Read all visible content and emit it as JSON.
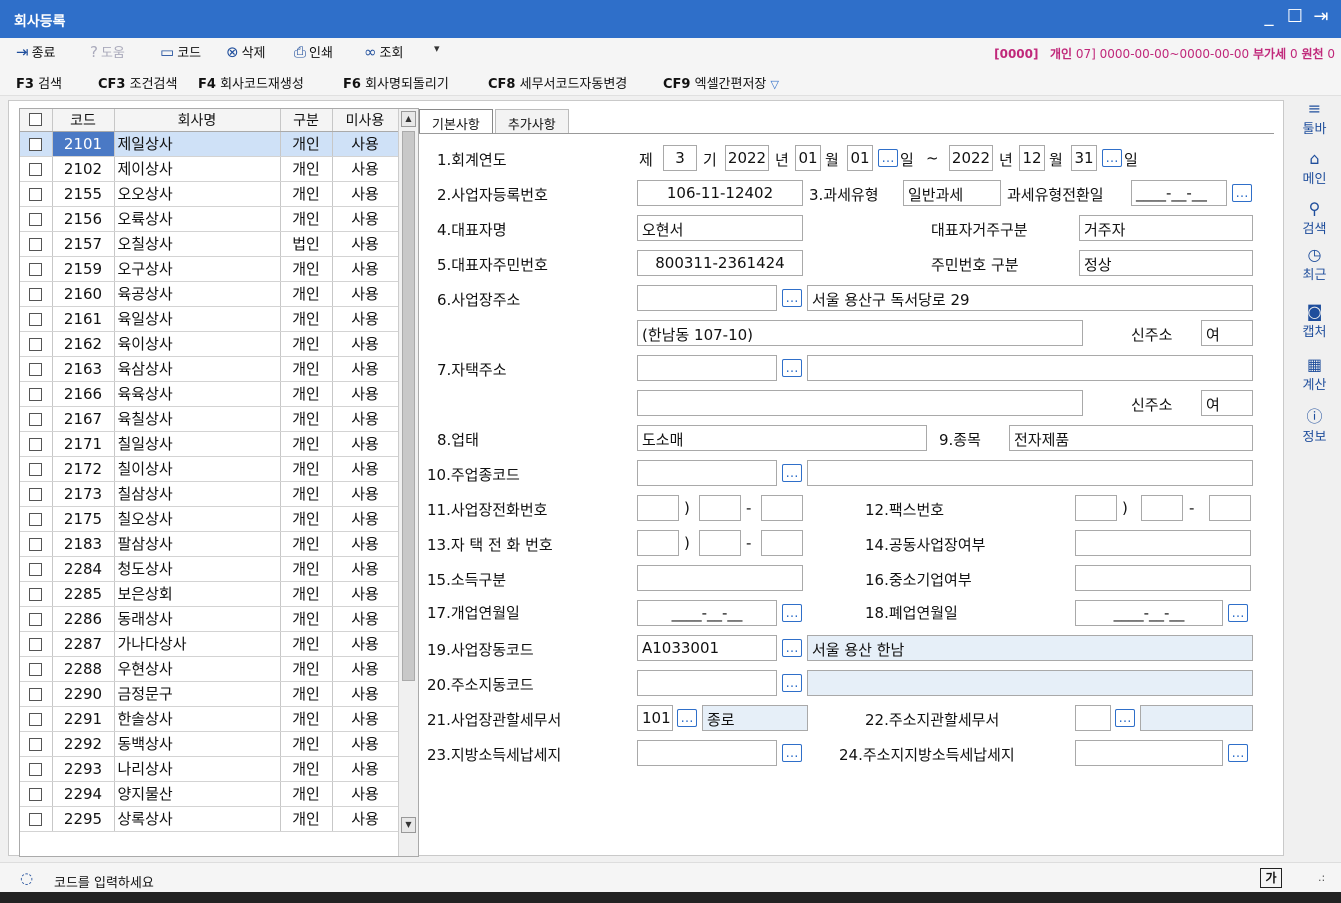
{
  "window": {
    "title": "회사등록",
    "min": "_",
    "max": "☐",
    "close": "⇥"
  },
  "toolbar": [
    {
      "icon": "⇥",
      "label": "종료",
      "name": "exit"
    },
    {
      "icon": "?",
      "label": "도움",
      "name": "help",
      "disabled": true
    },
    {
      "icon": "▭",
      "label": "코드",
      "name": "code"
    },
    {
      "icon": "⊗",
      "label": "삭제",
      "name": "delete"
    },
    {
      "icon": "⎙",
      "label": "인쇄",
      "name": "print"
    },
    {
      "icon": "∞",
      "label": "조회",
      "name": "search"
    },
    {
      "icon": "▾",
      "label": "",
      "name": "more"
    }
  ],
  "info": {
    "code": "[0000]",
    "type": "개인",
    "num": "07]",
    "period": "0000-00-00~0000-00-00",
    "vat_label": "부가세",
    "vat": "0",
    "withholding_label": "원천",
    "withholding": "0"
  },
  "fkeys": [
    {
      "key": "F3",
      "label": "검색"
    },
    {
      "key": "CF3",
      "label": "조건검색"
    },
    {
      "key": "F4",
      "label": "회사코드재생성"
    },
    {
      "key": "F6",
      "label": "회사명되돌리기"
    },
    {
      "key": "CF8",
      "label": "세무서코드자동변경"
    },
    {
      "key": "CF9",
      "label": "엑셀간편저장"
    }
  ],
  "grid": {
    "headers": [
      "코드",
      "회사명",
      "구분",
      "미사용"
    ],
    "rows": [
      [
        "2101",
        "제일상사",
        "개인",
        "사용"
      ],
      [
        "2102",
        "제이상사",
        "개인",
        "사용"
      ],
      [
        "2155",
        "오오상사",
        "개인",
        "사용"
      ],
      [
        "2156",
        "오륙상사",
        "개인",
        "사용"
      ],
      [
        "2157",
        "오칠상사",
        "법인",
        "사용"
      ],
      [
        "2159",
        "오구상사",
        "개인",
        "사용"
      ],
      [
        "2160",
        "육공상사",
        "개인",
        "사용"
      ],
      [
        "2161",
        "육일상사",
        "개인",
        "사용"
      ],
      [
        "2162",
        "육이상사",
        "개인",
        "사용"
      ],
      [
        "2163",
        "육삼상사",
        "개인",
        "사용"
      ],
      [
        "2166",
        "육육상사",
        "개인",
        "사용"
      ],
      [
        "2167",
        "육칠상사",
        "개인",
        "사용"
      ],
      [
        "2171",
        "칠일상사",
        "개인",
        "사용"
      ],
      [
        "2172",
        "칠이상사",
        "개인",
        "사용"
      ],
      [
        "2173",
        "칠삼상사",
        "개인",
        "사용"
      ],
      [
        "2175",
        "칠오상사",
        "개인",
        "사용"
      ],
      [
        "2183",
        "팔삼상사",
        "개인",
        "사용"
      ],
      [
        "2284",
        "청도상사",
        "개인",
        "사용"
      ],
      [
        "2285",
        "보은상회",
        "개인",
        "사용"
      ],
      [
        "2286",
        "동래상사",
        "개인",
        "사용"
      ],
      [
        "2287",
        "가나다상사",
        "개인",
        "사용"
      ],
      [
        "2288",
        "우현상사",
        "개인",
        "사용"
      ],
      [
        "2290",
        "금정문구",
        "개인",
        "사용"
      ],
      [
        "2291",
        "한솔상사",
        "개인",
        "사용"
      ],
      [
        "2292",
        "동백상사",
        "개인",
        "사용"
      ],
      [
        "2293",
        "나리상사",
        "개인",
        "사용"
      ],
      [
        "2294",
        "양지물산",
        "개인",
        "사용"
      ],
      [
        "2295",
        "상록상사",
        "개인",
        "사용"
      ]
    ]
  },
  "tabs": [
    "기본사항",
    "추가사항"
  ],
  "form": {
    "l1": "1.회계연도",
    "je": "제",
    "period_no": "3",
    "gi": "기",
    "from_year": "2022",
    "nyeon": "년",
    "from_month": "01",
    "wol": "월",
    "from_day": "01",
    "il": "일",
    "tilde": "~",
    "to_year": "2022",
    "to_month": "12",
    "to_day": "31",
    "l2": "2.사업자등록번호",
    "bizno": "106-11-12402",
    "l3": "3.과세유형",
    "taxtype": "일반과세",
    "l_taxchg": "과세유형전환일",
    "taxchg": "____-__-__",
    "l4": "4.대표자명",
    "ceo": "오현서",
    "l_res": "대표자거주구분",
    "res": "거주자",
    "l5": "5.대표자주민번호",
    "ceo_id": "800311-2361424",
    "l_idtype": "주민번호 구분",
    "idtype": "정상",
    "l6": "6.사업장주소",
    "addr_zip": "",
    "addr1": "서울 용산구 독서당로 29",
    "addr2": "(한남동 107-10)",
    "l_new": "신주소",
    "addr_new": "여",
    "l7": "7.자택주소",
    "home_zip": "",
    "home1": "",
    "home2": "",
    "home_new": "여",
    "l8": "8.업태",
    "biztype": "도소매",
    "l9": "9.종목",
    "item": "전자제품",
    "l10": "10.주업종코드",
    "indcode": "",
    "indname": "",
    "l11": "11.사업장전화번호",
    "paren": ")",
    "dash": "-",
    "l12": "12.팩스번호",
    "l13": "13.자 택 전 화 번호",
    "l14": "14.공동사업장여부",
    "l15": "15.소득구분",
    "l16": "16.중소기업여부",
    "l17": "17.개업연월일",
    "open_date": "____-__-__",
    "l18": "18.폐업연월일",
    "close_date": "____-__-__",
    "l19": "19.사업장동코드",
    "dongcode": "A1033001",
    "dongname": "서울 용산 한남",
    "l20": "20.주소지동코드",
    "l21": "21.사업장관할세무서",
    "taxoffice_code": "101",
    "taxoffice_name": "종로",
    "l22": "22.주소지관할세무서",
    "l23": "23.지방소득세납세지",
    "l24": "24.주소지지방소득세납세지"
  },
  "right_sidebar": [
    {
      "icon": "≡",
      "label": "툴바",
      "name": "toolbar"
    },
    {
      "icon": "⌂",
      "label": "메인",
      "name": "main"
    },
    {
      "icon": "⚲",
      "label": "검색",
      "name": "search"
    },
    {
      "icon": "◷",
      "label": "최근",
      "name": "recent"
    },
    {
      "icon": "◙",
      "label": "캡처",
      "name": "capture"
    },
    {
      "icon": "▦",
      "label": "계산",
      "name": "calc"
    },
    {
      "icon": "ⓘ",
      "label": "정보",
      "name": "info"
    }
  ],
  "status": {
    "message": "코드를 입력하세요",
    "ime": "가"
  }
}
